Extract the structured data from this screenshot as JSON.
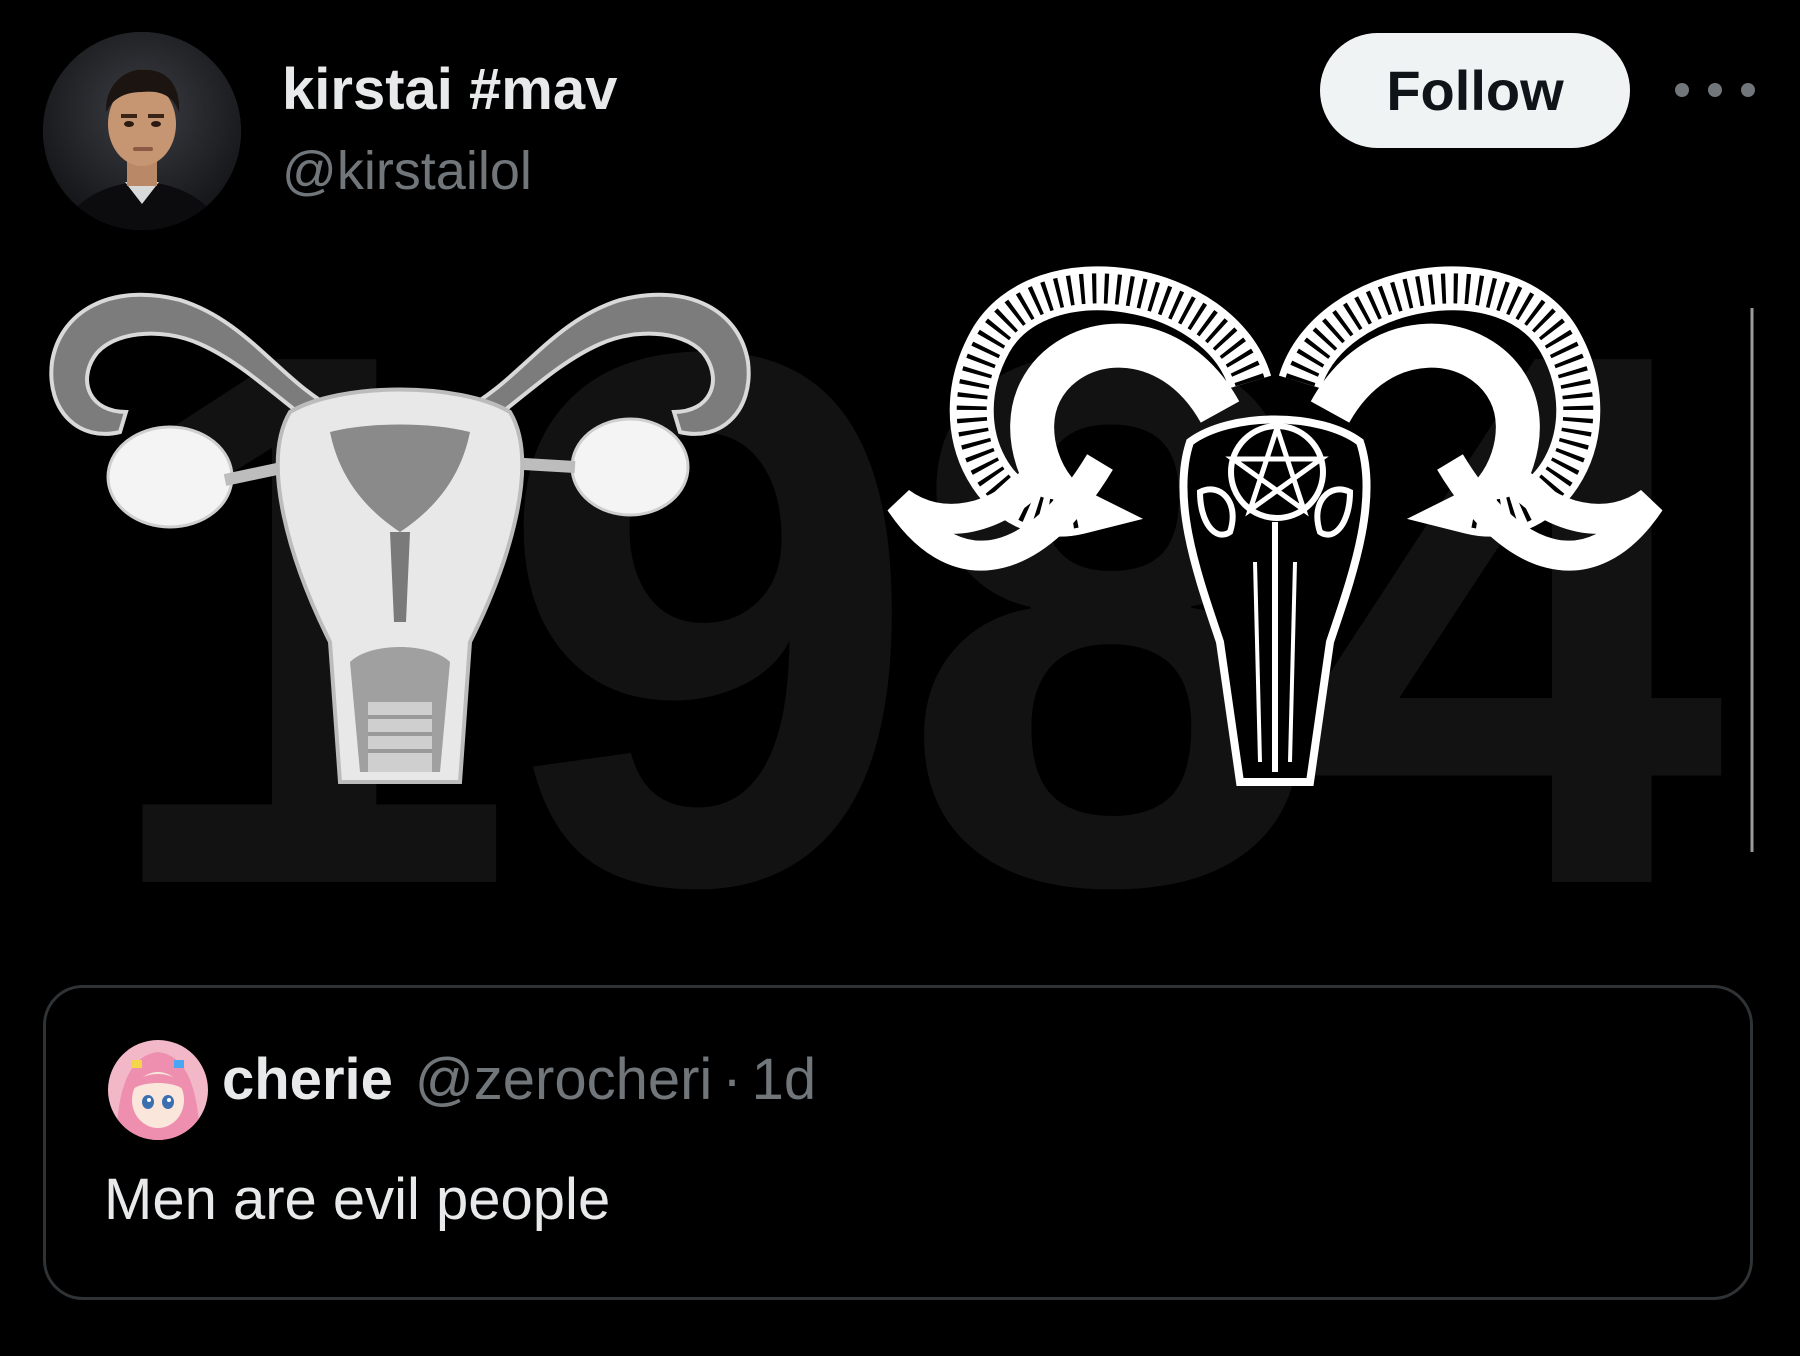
{
  "post": {
    "author": {
      "display_name": "kirstai #mav",
      "handle": "@kirstailol",
      "avatar_icon": "profile-photo"
    },
    "follow_label": "Follow",
    "more_icon": "more-horizontal-icon",
    "media": {
      "background_text": "1984",
      "left_image": "uterus-illustration",
      "right_image": "ram-skull-pentagram-illustration"
    }
  },
  "quoted_post": {
    "author": {
      "display_name": "cherie",
      "handle": "@zerocheri",
      "separator": "·",
      "time": "1d",
      "avatar_icon": "anime-avatar"
    },
    "text": "Men are evil people"
  },
  "colors": {
    "background": "#000000",
    "text_primary": "#e7e9ea",
    "text_secondary": "#71767b",
    "follow_bg": "#eff3f4",
    "border": "#2f3336"
  }
}
